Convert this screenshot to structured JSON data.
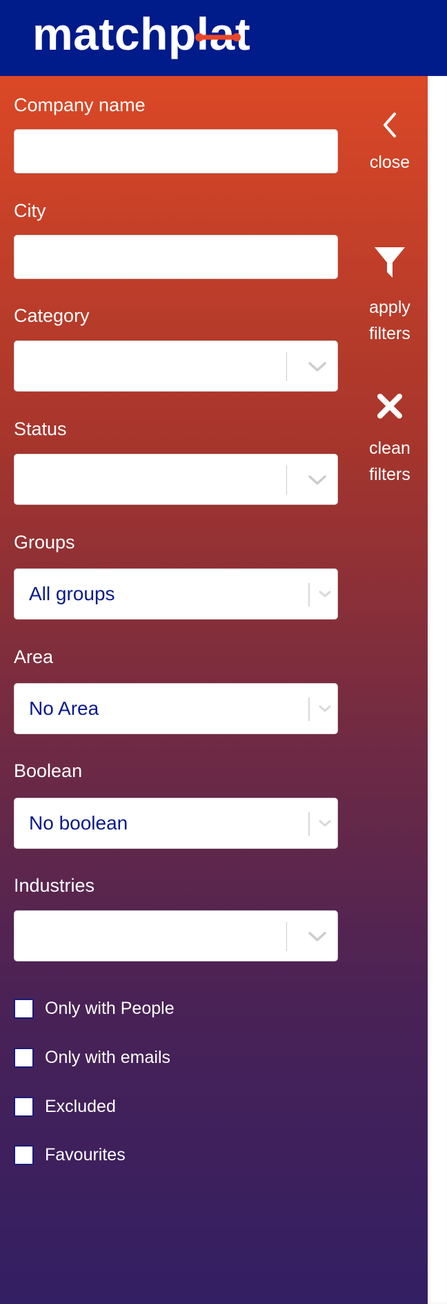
{
  "header": {
    "logo_text": "matchplat",
    "background_color": "#001b8a"
  },
  "filters": {
    "company_name": {
      "label": "Company name",
      "value": "",
      "placeholder": ""
    },
    "city": {
      "label": "City",
      "value": "",
      "placeholder": ""
    },
    "category": {
      "label": "Category",
      "value": ""
    },
    "status": {
      "label": "Status",
      "value": ""
    },
    "groups": {
      "label": "Groups",
      "value": "All groups"
    },
    "area": {
      "label": "Area",
      "value": "No Area"
    },
    "boolean": {
      "label": "Boolean",
      "value": "No boolean"
    },
    "industries": {
      "label": "Industries",
      "value": ""
    }
  },
  "checkboxes": [
    {
      "label": "Only with People",
      "checked": false
    },
    {
      "label": "Only with emails",
      "checked": false
    },
    {
      "label": "Excluded",
      "checked": false
    },
    {
      "label": "Favourites",
      "checked": false
    }
  ],
  "actions": {
    "close": {
      "label": "close",
      "icon": "chevron-left-icon"
    },
    "apply": {
      "label_line1": "apply",
      "label_line2": "filters",
      "icon": "funnel-icon"
    },
    "clean": {
      "label_line1": "clean",
      "label_line2": "filters",
      "icon": "close-x-icon"
    }
  },
  "colors": {
    "panel_top": "#db4826",
    "panel_bottom": "#331f63",
    "accent_blue": "#001b8a",
    "logo_accent": "#e8462a"
  }
}
